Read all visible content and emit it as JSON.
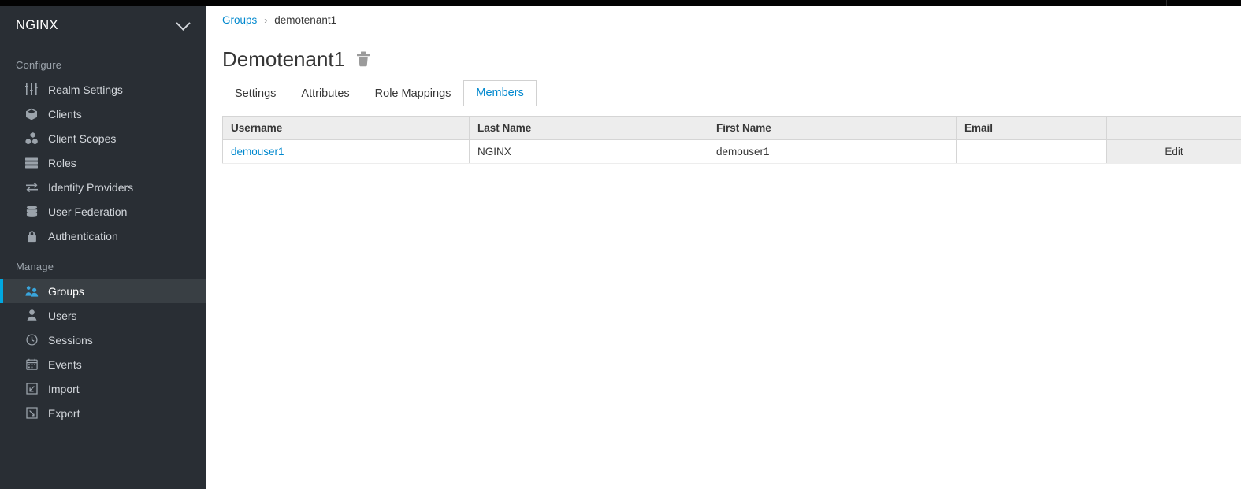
{
  "colors": {
    "accent": "#0088ce",
    "sidebar_bg": "#292e34",
    "sidebar_active_bg": "#393f44",
    "sidebar_active_bar": "#00a8e1",
    "masthead": "#030303",
    "text": "#363636"
  },
  "masthead": {
    "label": ""
  },
  "sidebar": {
    "realm": {
      "name": "NGINX",
      "chevron": "chevron-down-icon"
    },
    "sections": [
      {
        "title": "Configure",
        "items": [
          {
            "label": "Realm Settings",
            "icon": "sliders-icon",
            "active": false
          },
          {
            "label": "Clients",
            "icon": "cube-icon",
            "active": false
          },
          {
            "label": "Client Scopes",
            "icon": "cubes-icon",
            "active": false
          },
          {
            "label": "Roles",
            "icon": "list-rows-icon",
            "active": false
          },
          {
            "label": "Identity Providers",
            "icon": "exchange-arrows-icon",
            "active": false
          },
          {
            "label": "User Federation",
            "icon": "database-icon",
            "active": false
          },
          {
            "label": "Authentication",
            "icon": "lock-icon",
            "active": false
          }
        ]
      },
      {
        "title": "Manage",
        "items": [
          {
            "label": "Groups",
            "icon": "users-group-icon",
            "active": true
          },
          {
            "label": "Users",
            "icon": "user-icon",
            "active": false
          },
          {
            "label": "Sessions",
            "icon": "clock-icon",
            "active": false
          },
          {
            "label": "Events",
            "icon": "calendar-icon",
            "active": false
          },
          {
            "label": "Import",
            "icon": "import-arrow-icon",
            "active": false
          },
          {
            "label": "Export",
            "icon": "export-arrow-icon",
            "active": false
          }
        ]
      }
    ]
  },
  "main": {
    "breadcrumb": {
      "link": "Groups",
      "separator": "›",
      "current": "demotenant1"
    },
    "page_title": "Demotenant1",
    "delete_icon": "trash-icon",
    "tabs": [
      {
        "label": "Settings",
        "active": false
      },
      {
        "label": "Attributes",
        "active": false
      },
      {
        "label": "Role Mappings",
        "active": false
      },
      {
        "label": "Members",
        "active": true
      }
    ],
    "table": {
      "headers": [
        "Username",
        "Last Name",
        "First Name",
        "Email",
        ""
      ],
      "rows": [
        {
          "username": "demouser1",
          "last_name": "NGINX",
          "first_name": "demouser1",
          "email": "",
          "action": "Edit"
        }
      ]
    }
  }
}
